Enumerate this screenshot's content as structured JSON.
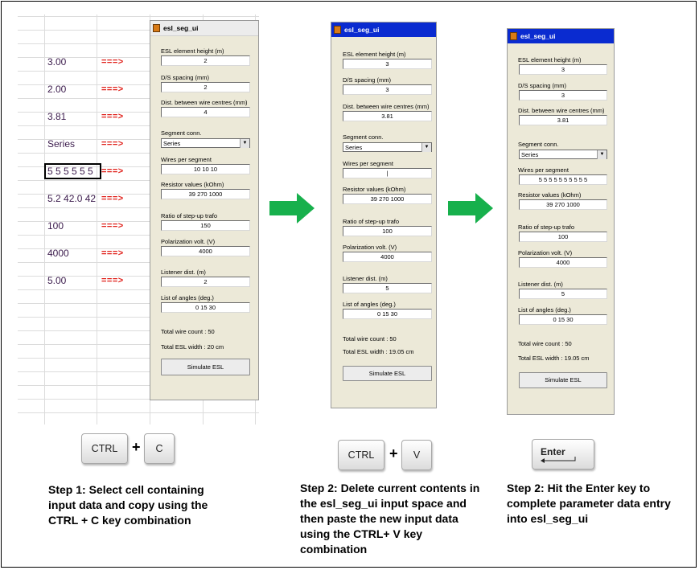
{
  "spreadsheet": {
    "values": [
      "3.00",
      "2.00",
      "3.81",
      "Series",
      "5 5 5 5 5 5",
      "5.2 42.0 42",
      "100",
      "4000",
      "5.00"
    ],
    "arrow": "===>"
  },
  "dialogs": [
    {
      "title": "esl_seg_ui",
      "labels": [
        "ESL element height (m)",
        "D/S spacing (mm)",
        "Dist. between wire centres (mm)",
        "Segment conn.",
        "Wires per segment",
        "Resistor values (kOhm)",
        "Ratio of step-up trafo",
        "Polarization volt. (V)",
        "Listener dist. (m)",
        "List of angles (deg.)"
      ],
      "values": [
        "2",
        "2",
        "4",
        "Series",
        "10 10 10",
        "39 270 1000",
        "150",
        "4000",
        "2",
        "0 15 30"
      ],
      "total_wire_count": "Total wire count :   50",
      "total_esl_width": "Total ESL width :   20 cm",
      "simulate": "Simulate ESL"
    },
    {
      "title": "esl_seg_ui",
      "labels": [
        "ESL element height (m)",
        "D/S spacing (mm)",
        "Dist. between wire centres (mm)",
        "Segment conn.",
        "Wires per segment",
        "Resistor values (kOhm)",
        "Ratio of step-up trafo",
        "Polarization volt. (V)",
        "Listener dist. (m)",
        "List of angles (deg.)"
      ],
      "values": [
        "3",
        "3",
        "3.81",
        "Series",
        "|",
        "39 270 1000",
        "100",
        "4000",
        "5",
        "0 15 30"
      ],
      "total_wire_count": "Total wire count :   50",
      "total_esl_width": "Total ESL width :   19.05 cm",
      "simulate": "Simulate ESL"
    },
    {
      "title": "esl_seg_ui",
      "labels": [
        "ESL element height (m)",
        "D/S spacing (mm)",
        "Dist. between wire centres (mm)",
        "Segment conn.",
        "Wires per segment",
        "Resistor values (kOhm)",
        "Ratio of step-up trafo",
        "Polarization volt. (V)",
        "Listener dist. (m)",
        "List of angles (deg.)"
      ],
      "values": [
        "3",
        "3",
        "3.81",
        "Series",
        "5 5 5 5 5 5 5 5 5 5",
        "39 270 1000",
        "100",
        "4000",
        "5",
        "0 15 30"
      ],
      "total_wire_count": "Total wire count :   50",
      "total_esl_width": "Total ESL width :   19.05 cm",
      "simulate": "Simulate ESL"
    }
  ],
  "keys": {
    "ctrl": "CTRL",
    "plus": "+",
    "c": "C",
    "v": "V",
    "enter": "Enter"
  },
  "steps": [
    "Step 1: Select cell containing input data and copy using the CTRL + C key combination",
    "Step 2: Delete current contents in the esl_seg_ui input space and then paste the new input data using the CTRL+ V key combination",
    "Step 2: Hit the Enter key to complete parameter data entry into esl_seg_ui"
  ],
  "colors": {
    "titlebar": "#0a2bd0",
    "dialog_bg": "#ece9d8",
    "arrow_green": "#17b04c",
    "arrow_text": "#e0201a",
    "cell_text": "#3b1b4c"
  }
}
